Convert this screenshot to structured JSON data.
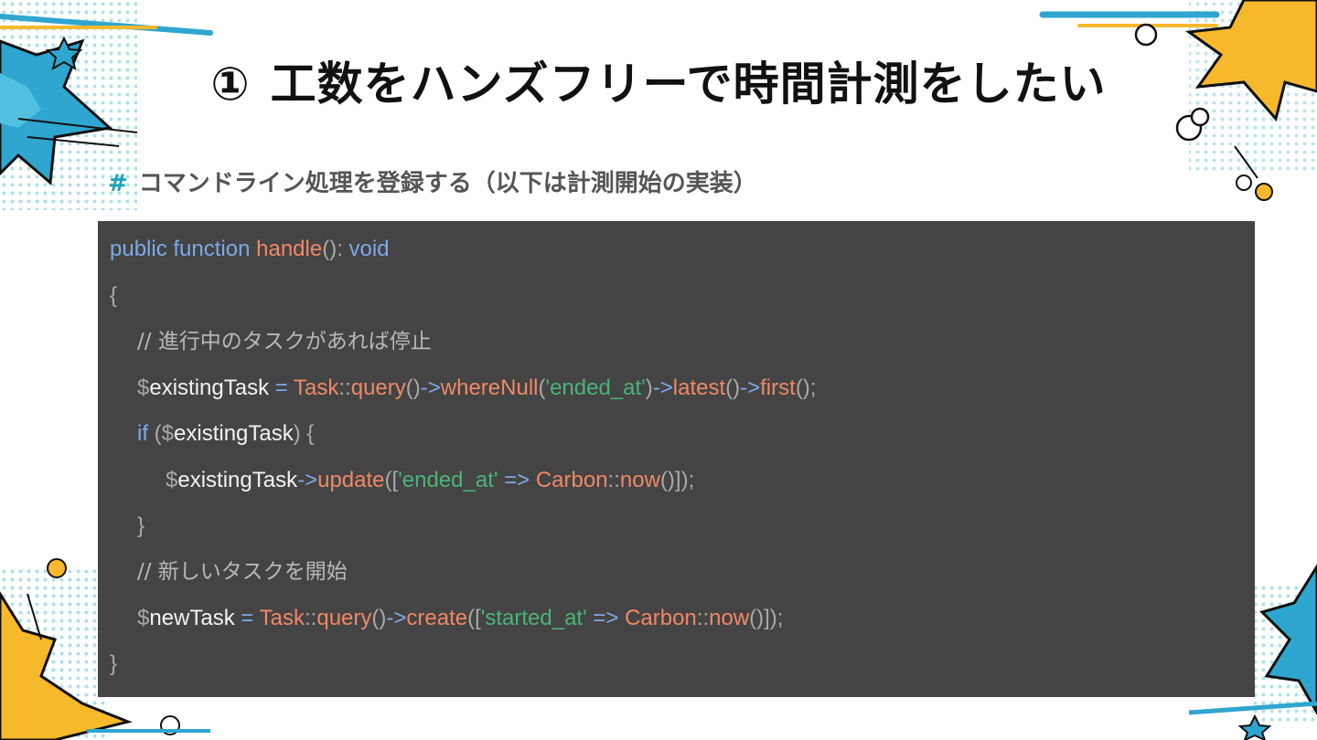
{
  "slide": {
    "title_num": "①",
    "title_text": "工数をハンズフリーで時間計測をしたい",
    "subtitle_hash": "#",
    "subtitle_text": "コマンドライン処理を登録する（以下は計測開始の実装）"
  },
  "code": {
    "l1": {
      "public": "public",
      "function": "function",
      "handle": "handle",
      "paren": "()",
      "colon": ":",
      "void": "void"
    },
    "l2": {
      "brace": "{"
    },
    "l3": {
      "comment": "// 進行中のタスクがあれば停止"
    },
    "l4": {
      "dollar": "$",
      "var": "existingTask",
      "eq": " = ",
      "cls": "Task",
      "dc": "::",
      "query": "query",
      "p1": "()",
      "arrow1": "->",
      "whereNull": "whereNull",
      "po": "(",
      "str": "'ended_at'",
      "pc": ")",
      "arrow2": "->",
      "latest": "latest",
      "p2": "()",
      "arrow3": "->",
      "first": "first",
      "end": "();"
    },
    "l5": {
      "if": "if",
      "po": " (",
      "dollar": "$",
      "var": "existingTask",
      "pc": ") {"
    },
    "l6": {
      "dollar": "$",
      "var": "existingTask",
      "arrow": "->",
      "update": "update",
      "po": "([",
      "str": "'ended_at'",
      "fat": " => ",
      "cls": "Carbon",
      "dc": "::",
      "now": "now",
      "end": "()]);"
    },
    "l7": {
      "brace": "}"
    },
    "l8": {
      "comment": "// 新しいタスクを開始"
    },
    "l9": {
      "dollar": "$",
      "var": "newTask",
      "eq": " = ",
      "cls": "Task",
      "dc": "::",
      "query": "query",
      "p1": "()",
      "arrow": "->",
      "create": "create",
      "po": "([",
      "str": "'started_at'",
      "fat": " => ",
      "cls2": "Carbon",
      "dc2": "::",
      "now": "now",
      "end": "()]);"
    },
    "l10": {
      "brace": "}"
    }
  },
  "colors": {
    "keyword": "#7fa8e8",
    "function": "#f08866",
    "string": "#4cb377",
    "panel": "#444444",
    "accent_teal": "#1aa3b5",
    "accent_yellow": "#f6b92b"
  }
}
